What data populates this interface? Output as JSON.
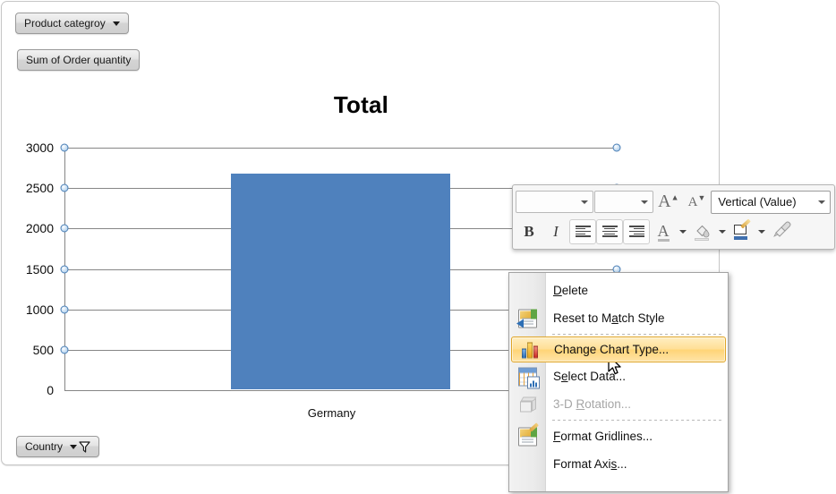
{
  "pivot_buttons": {
    "product_category": "Product categroy",
    "sum_of_order_quantity": "Sum of Order quantity",
    "country": "Country"
  },
  "chart_data": {
    "type": "bar",
    "title": "Total",
    "categories": [
      "Germany"
    ],
    "values": [
      2680
    ],
    "series": [
      {
        "name": "Total",
        "values": [
          2680
        ]
      }
    ],
    "xlabel": "",
    "ylabel": "",
    "ylim": [
      0,
      3000
    ],
    "yticks": [
      3000,
      2500,
      2000,
      1500,
      1000,
      500,
      0
    ],
    "grid": true,
    "legend": false,
    "bar_color": "#4F81BD",
    "gridline_color": "#868686",
    "selected_element": "Vertical (Value) Axis Major Gridlines"
  },
  "mini_toolbar": {
    "font_name": "",
    "font_name_placeholder": "",
    "font_size": "",
    "font_size_placeholder": "",
    "grow_font": "A",
    "shrink_font": "A",
    "chart_element": "Vertical (Value)",
    "bold": "B",
    "italic": "I",
    "align_left": "Align Text Left",
    "align_center": "Center",
    "align_right": "Align Text Right",
    "font_color": "A",
    "fill_color": "Fill Color",
    "shape_outline": "Shape Outline",
    "format_painter": "Format Painter"
  },
  "context_menu": {
    "items": [
      {
        "label": "Delete",
        "accel": "D",
        "icon": "",
        "state": "normal"
      },
      {
        "label": "Reset to Match Style",
        "accel": "a",
        "icon": "reset-style-icon",
        "state": "normal"
      },
      {
        "label": "Change Chart Type...",
        "accel": "g",
        "icon": "change-chart-type-icon",
        "state": "highlighted"
      },
      {
        "label": "Select Data...",
        "accel": "e",
        "icon": "select-data-icon",
        "state": "normal"
      },
      {
        "label": "3-D Rotation...",
        "accel": "R",
        "icon": "3d-rotation-icon",
        "state": "disabled"
      },
      {
        "label": "Format Gridlines...",
        "accel": "F",
        "icon": "format-gridlines-icon",
        "state": "normal"
      },
      {
        "label": "Format Axis...",
        "accel": "s",
        "icon": "",
        "state": "normal"
      }
    ]
  },
  "colors": {
    "bar": "#4F81BD",
    "highlight_border": "#E0A526",
    "gridline": "#868686"
  }
}
